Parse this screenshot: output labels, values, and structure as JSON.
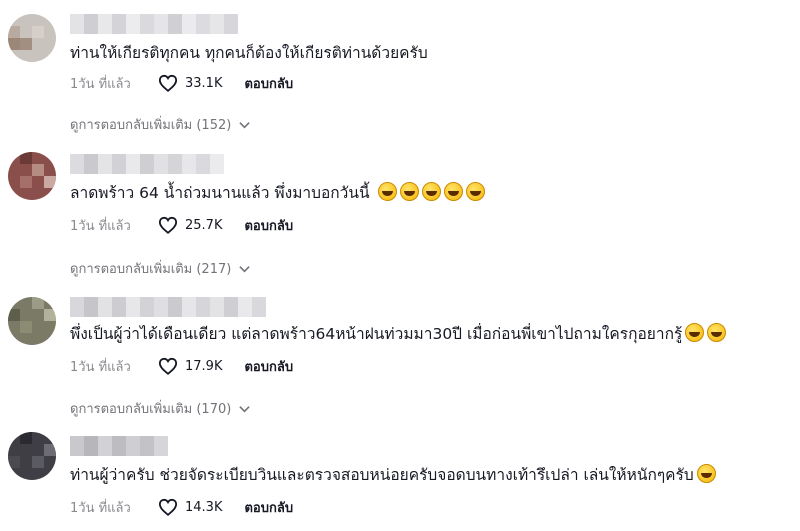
{
  "comments": [
    {
      "text": "ท่านให้เกียรติทุกคน ทุกคนก็ต้องให้เกียรติท่านด้วยครับ",
      "emoji_count": 0,
      "time": "1วัน ที่แล้ว",
      "likes": "33.1K",
      "reply_label": "ตอบกลับ",
      "view_replies": "ดูการตอบกลับเพิ่มเติม (152)"
    },
    {
      "text": "ลาดพร้าว 64 น้ำถ่วมนานแล้ว พึ่งมาบอกวันนี้",
      "emoji_count": 5,
      "time": "1วัน ที่แล้ว",
      "likes": "25.7K",
      "reply_label": "ตอบกลับ",
      "view_replies": "ดูการตอบกลับเพิ่มเติม (217)"
    },
    {
      "text": "พึ่งเป็นผู้ว่าได้เดือนเดียว แต่ลาดพร้าว64หน้าฝนท่วมมา30ปี เมื่อก่อนพี่เขาไปถามใครกุอยากรู้",
      "emoji_count": 2,
      "time": "1วัน ที่แล้ว",
      "likes": "17.9K",
      "reply_label": "ตอบกลับ",
      "view_replies": "ดูการตอบกลับเพิ่มเติม (170)"
    },
    {
      "text": "ท่านผู้ว่าครับ ช่วยจัดระเบียบวินและตรวจสอบหน่อยครับจอดบนทางเท้ารึเปล่า เล่นให้หนักๆครับ",
      "emoji_count": 1,
      "time": "1วัน ที่แล้ว",
      "likes": "14.3K",
      "reply_label": "ตอบกลับ",
      "view_replies": ""
    }
  ],
  "icons": {
    "like": "heart-outline-icon",
    "expand": "chevron-down-icon",
    "emoji": "laughing-face-icon"
  },
  "colors": {
    "text": "#161823",
    "muted": "#8a8b91",
    "blurred_username": "#d9d9dc"
  }
}
